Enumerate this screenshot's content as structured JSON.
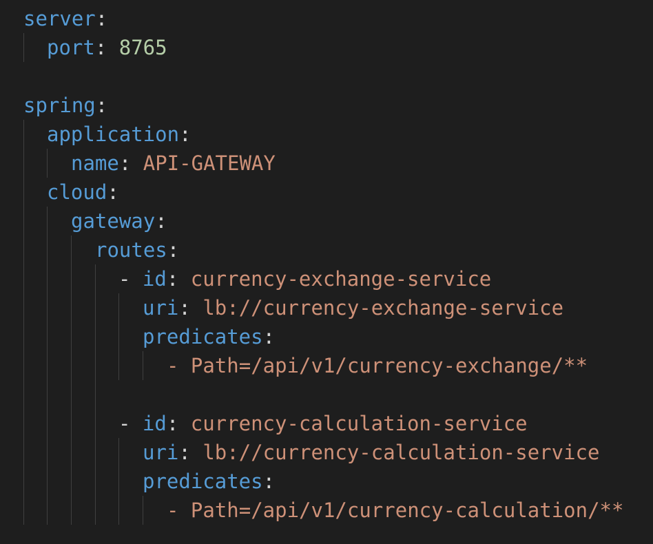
{
  "editor": {
    "language": "yaml",
    "theme_colors": {
      "background": "#1e1e1e",
      "key": "#569cd6",
      "string": "#ce9178",
      "number": "#b5cea8",
      "punctuation": "#d4d4d4"
    },
    "lines": {
      "server": {
        "key": "server",
        "colon": ":"
      },
      "port": {
        "key": "port",
        "colon": ": ",
        "value": "8765"
      },
      "spring": {
        "key": "spring",
        "colon": ":"
      },
      "application": {
        "key": "application",
        "colon": ":"
      },
      "name": {
        "key": "name",
        "colon": ": ",
        "value": "API-GATEWAY"
      },
      "cloud": {
        "key": "cloud",
        "colon": ":"
      },
      "gateway": {
        "key": "gateway",
        "colon": ":"
      },
      "routes": {
        "key": "routes",
        "colon": ":"
      },
      "routes_list": [
        {
          "dash": "- ",
          "id_key": "id",
          "id_colon": ": ",
          "id_value": "currency-exchange-service",
          "uri_key": "uri",
          "uri_colon": ": ",
          "uri_value": "lb://currency-exchange-service",
          "predicates_key": "predicates",
          "predicates_colon": ":",
          "predicate_item": "- Path=/api/v1/currency-exchange/**"
        },
        {
          "dash": "- ",
          "id_key": "id",
          "id_colon": ": ",
          "id_value": "currency-calculation-service",
          "uri_key": "uri",
          "uri_colon": ": ",
          "uri_value": "lb://currency-calculation-service",
          "predicates_key": "predicates",
          "predicates_colon": ":",
          "predicate_item": "- Path=/api/v1/currency-calculation/**"
        }
      ]
    }
  }
}
